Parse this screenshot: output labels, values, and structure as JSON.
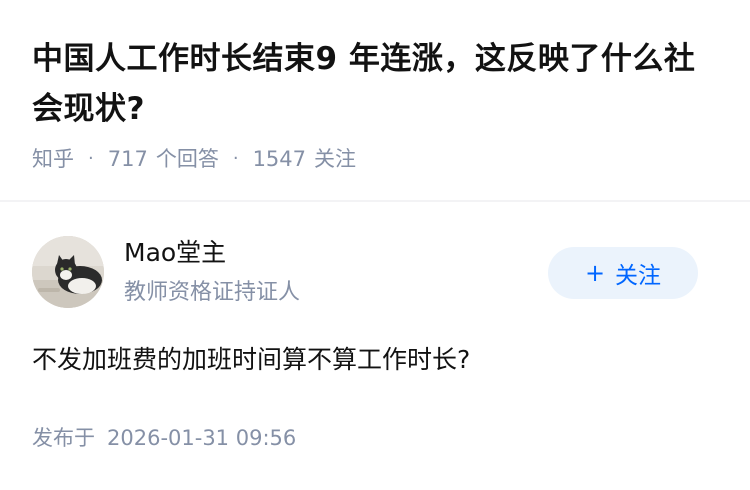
{
  "question": {
    "title": "中国人工作时长结束9 年连涨，这反映了什么社会现状?",
    "source": "知乎",
    "separator": "·",
    "answer_count": "717",
    "answer_label": "个回答",
    "follower_count": "1547",
    "follower_label": "关注"
  },
  "author": {
    "name": "Mao堂主",
    "bio": "教师资格证持证人",
    "avatar_icon": "cat-avatar-photo",
    "follow_plus": "+",
    "follow_label": "关注"
  },
  "answer": {
    "text": "不发加班费的加班时间算不算工作时长?",
    "publish_label": "发布于",
    "publish_time": "2026-01-31 09:56"
  },
  "colors": {
    "text_primary": "#121212",
    "text_secondary": "#8590a6",
    "accent": "#0066ff",
    "button_bg": "#ebf3fc"
  }
}
